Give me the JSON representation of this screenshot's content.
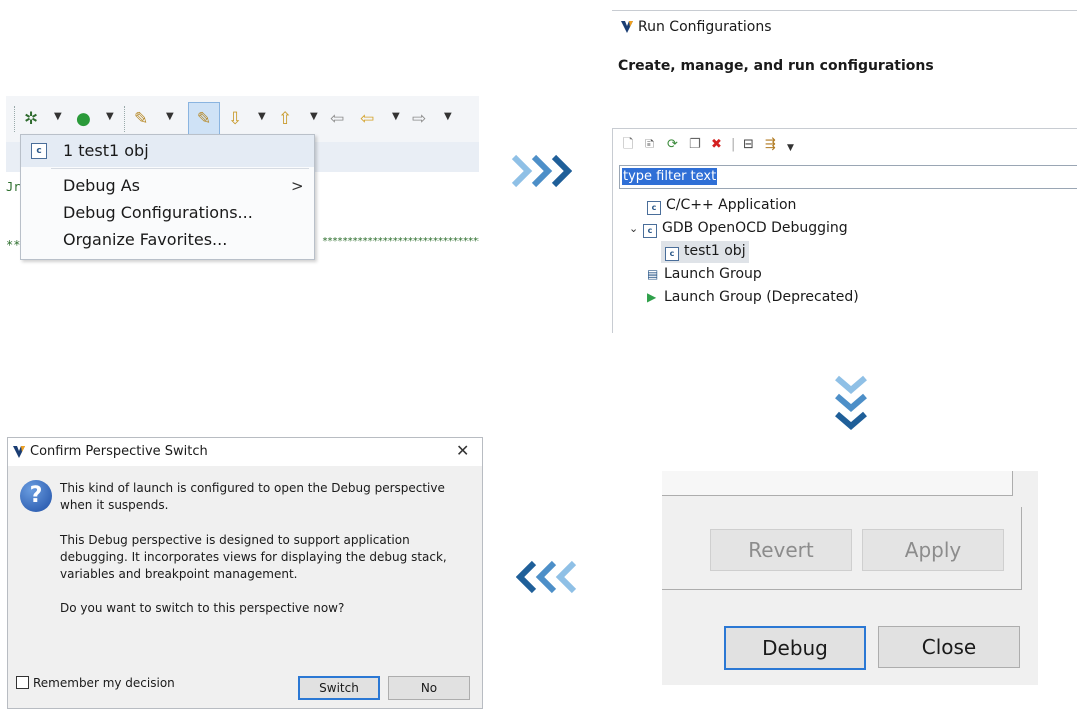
{
  "toolbar_menu": {
    "recent_item": "1 test1 obj",
    "recent_item_icon": "c-config-icon",
    "items": [
      "Debug As",
      "Debug Configurations...",
      "Organize Favorites..."
    ],
    "submenu_indicator": ">"
  },
  "run_configurations": {
    "window_title": "Run Configurations",
    "subtitle": "Create, manage, and run configurations",
    "filter_text": "type filter text",
    "tree": [
      {
        "label": "C/C++ Application",
        "icon": "c-config-icon"
      },
      {
        "label": "GDB OpenOCD Debugging",
        "icon": "c-config-icon",
        "expanded": true
      },
      {
        "label": "test1 obj",
        "icon": "c-config-icon",
        "selected": true
      },
      {
        "label": "Launch Group",
        "icon": "launch-group-icon"
      },
      {
        "label": "Launch Group (Deprecated)",
        "icon": "run-triangle-icon"
      }
    ]
  },
  "button_panel": {
    "revert": "Revert",
    "apply": "Apply",
    "debug": "Debug",
    "close": "Close"
  },
  "confirm_dialog": {
    "title": "Confirm Perspective Switch",
    "paragraph1": "This kind of launch is configured to open the Debug perspective when it suspends.",
    "paragraph2": "This Debug perspective is designed to support application debugging. It incorporates views for displaying the debug stack, variables and breakpoint management.",
    "paragraph3": "Do you want to switch to this perspective now?",
    "remember_label": "Remember my decision",
    "switch_label": "Switch",
    "no_label": "No"
  },
  "colors": {
    "accent": "#2b78d4",
    "arrow_dark": "#1f5f99",
    "arrow_light": "#6aa9db",
    "selection": "#2f6fd6"
  }
}
